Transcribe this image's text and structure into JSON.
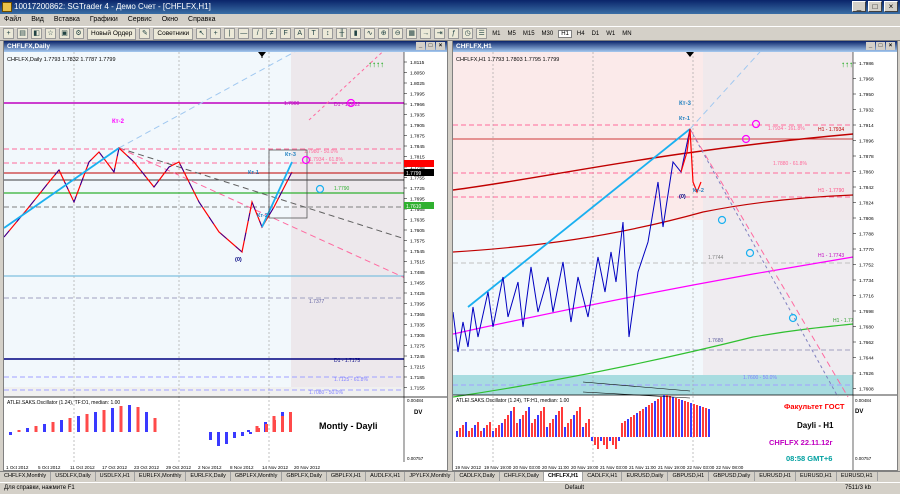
{
  "window": {
    "title": "10017200862: SGTrader 4 - Демо Счет - [CHFLFX,H1]",
    "min": "_",
    "max": "□",
    "close": "×"
  },
  "menu": [
    "Файл",
    "Вид",
    "Вставка",
    "Графики",
    "Сервис",
    "Окно",
    "Справка"
  ],
  "toolbar": {
    "new_order": "Новый Ордер",
    "advisors": "Советники",
    "timeframes": [
      "M1",
      "M5",
      "M15",
      "M30",
      "H1",
      "H4",
      "D1",
      "W1",
      "MN"
    ],
    "active_tf": "H1"
  },
  "left_chart": {
    "window_title": "CHFLFX,Daily",
    "info": "CHFLFX,Daily  1.7793 1.7832 1.7787 1.7799",
    "price_ticks": [
      "1.8115",
      "1.8050",
      "1.8025",
      "1.7995",
      "1.7966",
      "1.7935",
      "1.7905",
      "1.7875",
      "1.7845",
      "1.7815",
      "1.7785",
      "1.7755",
      "1.7725",
      "1.7695",
      "1.7665",
      "1.7635",
      "1.7605",
      "1.7575",
      "1.7545",
      "1.7515",
      "1.7485",
      "1.7455",
      "1.7425",
      "1.7395",
      "1.7365",
      "1.7335",
      "1.7305",
      "1.7275",
      "1.7245",
      "1.7215",
      "1.7185",
      "1.7155"
    ],
    "current_price": "1.7799",
    "tag_price": "1.7610",
    "arrows": "↑↑↑↑",
    "wave_labels": {
      "kt2": "Кт-2",
      "kt3": "Кт-3",
      "kt1": "Кт-1",
      "kt_2": "Кт-2",
      "zero": "(0)"
    },
    "levels": {
      "d1a": "D1 - 1.8022",
      "d1b": "D1 - 1.7175",
      "pct1": "1.7980 - 50.0%",
      "pct2": "1.7934 - 61.8%",
      "v1": "1.7900",
      "v2": "1.7790",
      "v3": "1.7377",
      "v4": "1.7125 - 61.8%",
      "v5": "1.7080 - 50.0%"
    },
    "osc_label": "ATLEI.SAKS.Oscillator (1.24), TF:D1, median: 1.00",
    "osc_ticks": [
      "0.00484",
      "0.00757"
    ],
    "osc_dv": "DV",
    "caption": "Montly - Dayli",
    "dates": [
      "1 Oct 2012",
      "5 Oct 2012",
      "11 Oct 2012",
      "17 Oct 2012",
      "23 Oct 2012",
      "29 Oct 2012",
      "2 Nov 2012",
      "8 Nov 2012",
      "14 Nov 2012",
      "20 Nov 2012"
    ]
  },
  "right_chart": {
    "window_title": "CHFLFX,H1",
    "info": "CHFLFX,H1  1.7793 1.7803 1.7795 1.7799",
    "price_ticks": [
      "1.7986",
      "1.7968",
      "1.7950",
      "1.7932",
      "1.7914",
      "1.7896",
      "1.7878",
      "1.7860",
      "1.7842",
      "1.7824",
      "1.7806",
      "1.7788",
      "1.7770",
      "1.7752",
      "1.7734",
      "1.7716",
      "1.7698",
      "1.7680",
      "1.7662",
      "1.7644",
      "1.7626",
      "1.7608"
    ],
    "arrows": "↑↑↑↑",
    "wave_labels": {
      "kt3": "Кт-3",
      "kt1": "Кт-1",
      "zero": "(0)",
      "kt2": "Кт-2"
    },
    "levels": {
      "h1a": "H1 - 1.7934",
      "h1b": "H1 - 1.7790",
      "h1c": "H1 - 1.7743",
      "h1d": "H1 - 1.7705",
      "p1": "1.7934 - 161.8%",
      "p2": "1.7880 - 61.8%",
      "p3": "1.7744",
      "p4": "1.7680",
      "p5": "1.7600 - 50.0%"
    },
    "osc_label": "ATLEI.SAKS.Oscillator (1.24), TF:H1, median: 1.00",
    "osc_ticks": [
      "0.00484",
      "0.00757"
    ],
    "osc_dv": "DV",
    "overlay": {
      "line1": "Факультет ГОСТ",
      "line2": "Dayli - H1",
      "line3": "CHFLFX 22.11.12г",
      "line4": "08:58 GMT+6"
    },
    "dates": [
      "19 Nov 2012",
      "19 Nov 19:00",
      "20 Nov 03:00",
      "20 Nov 11:00",
      "20 Nov 19:00",
      "21 Nov 03:00",
      "21 Nov 11:00",
      "21 Nov 19:00",
      "22 Nov 03:00",
      "22 Nov 08:00"
    ]
  },
  "tabs": [
    "CHFLFX,Monthly",
    "USDLFX,Daily",
    "USDLFX,H1",
    "EURLFX,Monthly",
    "EURLFX,Daily",
    "GBPLFX,Monthly",
    "GBPLFX,Daily",
    "GBPLFX,H1",
    "AUDLFX,H1",
    "JPYLFX,Monthly",
    "CADLFX,Daily",
    "CHFLFX,Daily",
    "CHFLFX,H1",
    "CADLFX,H1",
    "EURUSD,Daily",
    "GBPUSD,H1",
    "GBPUSD,Daily",
    "EURUSD,H1",
    "EURUSD,H1",
    "EURUSD,H1"
  ],
  "active_tab": "CHFLFX,H1",
  "status": {
    "help": "Для справки, нажмите F1",
    "profile": "Default",
    "conn": "7511/3 kb"
  },
  "colors": {
    "red": "#ff0000",
    "blue": "#0000ff",
    "cyan": "#00b0f0",
    "magenta": "#ff00ff",
    "green": "#00b000",
    "navy": "#000080"
  }
}
